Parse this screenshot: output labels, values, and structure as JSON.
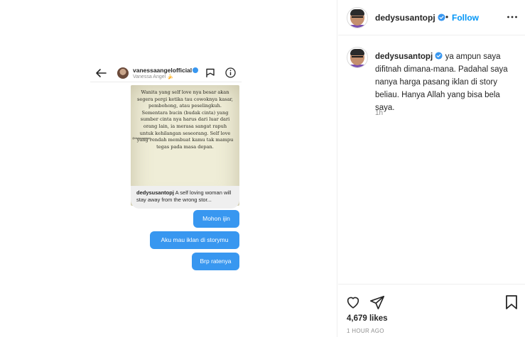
{
  "screenshot": {
    "header": {
      "username": "vanessaangelofficial",
      "subtitle": "Vanessa Angel 🍌"
    },
    "story_text": "Wanita yang self love nya besar akan segera pergi ketika tau cowoknya kasar, pembohong, atau peselingkuh. Sementara bucin (budak cinta) yang sumber cinta nya harus dari luar dari orang lain, ia merasa sangat rapuh untuk kehilangan seseorang. Self love yang rendah membuat kamu tak mampu tegas pada masa depan.",
    "story_tag": "@dedysusantopj",
    "caption_user": "dedysusantopj",
    "caption_text": "A self loving woman will stay away from the wrong stor...",
    "messages": [
      "Mohon ijin",
      "Aku mau iklan di storymu",
      "Brp ratenya"
    ]
  },
  "post": {
    "username": "dedysusantopj",
    "dot": "•",
    "follow_label": "Follow",
    "caption_user": "dedysusantopj",
    "caption": "ya ampun saya difitnah dimana-mana. Padahal saya nanya harga pasang iklan di story beliau. Hanya Allah yang bisa bela saya.",
    "caption_age": "1h",
    "likes": "4,679 likes",
    "time_ago": "1 HOUR AGO"
  },
  "colors": {
    "accent": "#0095f6",
    "bubble": "#3897f0",
    "verified": "#3897f0",
    "muted": "#8e8e8e"
  },
  "icons": [
    "back-arrow-icon",
    "flag-icon",
    "info-icon",
    "verified-icon",
    "more-icon",
    "heart-icon",
    "send-icon",
    "bookmark-icon"
  ]
}
